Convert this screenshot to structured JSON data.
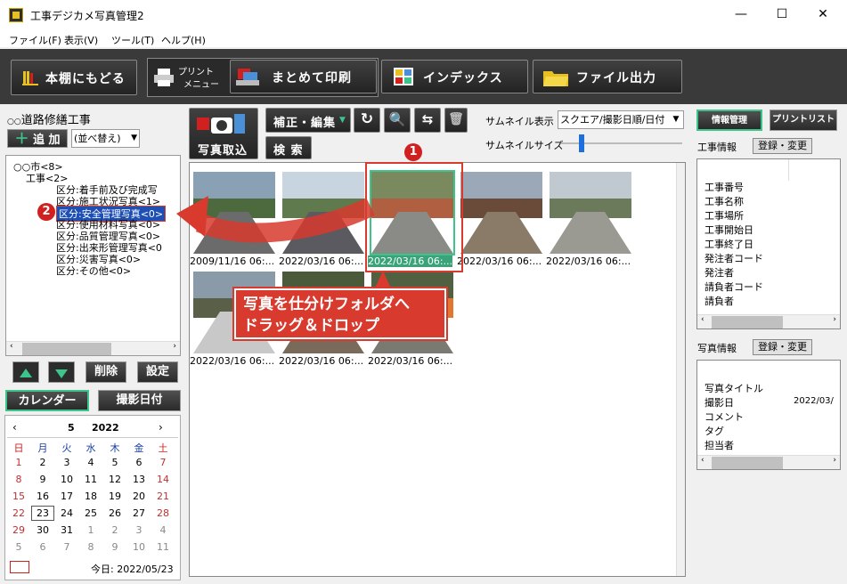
{
  "window": {
    "title": "工事デジカメ写真管理2",
    "minimize": "—",
    "maximize": "☐",
    "close": "✕"
  },
  "menu": [
    "ファイル(F)",
    "表示(V)",
    "ツール(T)",
    "ヘルプ(H)"
  ],
  "toolbar": {
    "back_label": "本棚にもどる",
    "print_menu_label_1": "プリント",
    "print_menu_label_2": "メニュー",
    "batch_print": "まとめて印刷",
    "index": "インデックス",
    "file_output": "ファイル出力"
  },
  "left": {
    "project_title": "道路修繕工事",
    "add_label": "追 加",
    "sort_label": "(並べ替え)",
    "tree": [
      {
        "text": "○○市<8>",
        "indent": 0
      },
      {
        "text": "工事<2>",
        "indent": 1
      },
      {
        "text": "区分:着手前及び完成写",
        "indent": 2
      },
      {
        "text": "区分:施工状況写真<1>",
        "indent": 2
      },
      {
        "text": "区分:安全管理写真<0>",
        "indent": 2,
        "selected": true
      },
      {
        "text": "区分:使用材料写真<0>",
        "indent": 2
      },
      {
        "text": "区分:品質管理写真<0>",
        "indent": 2
      },
      {
        "text": "区分:出来形管理写真<0",
        "indent": 2
      },
      {
        "text": "区分:災害写真<0>",
        "indent": 2
      },
      {
        "text": "区分:その他<0>",
        "indent": 2
      }
    ],
    "delete_label": "削除",
    "settings_label": "設定",
    "calendar_tab": "カレンダー",
    "shoot_date_tab": "撮影日付"
  },
  "calendar": {
    "month": "5",
    "year": "2022",
    "weekdays": [
      "日",
      "月",
      "火",
      "水",
      "木",
      "金",
      "土"
    ],
    "weeks": [
      [
        "1",
        "2",
        "3",
        "4",
        "5",
        "6",
        "7"
      ],
      [
        "8",
        "9",
        "10",
        "11",
        "12",
        "13",
        "14"
      ],
      [
        "15",
        "16",
        "17",
        "18",
        "19",
        "20",
        "21"
      ],
      [
        "22",
        "23",
        "24",
        "25",
        "26",
        "27",
        "28"
      ],
      [
        "29",
        "30",
        "31",
        "1",
        "2",
        "3",
        "4"
      ],
      [
        "5",
        "6",
        "7",
        "8",
        "9",
        "10",
        "11"
      ]
    ],
    "today_label": "今日: 2022/05/23"
  },
  "center": {
    "import_label": "写真取込",
    "edit_label": "補正・編集",
    "search_label": "検 索",
    "thumb_display_label": "サムネイル表示",
    "thumb_display_value": "スクエア/撮影日順/日付",
    "thumb_size_label": "サムネイルサイズ",
    "thumb_size_level": 0.3,
    "photos": [
      {
        "caption": "2009/11/16 06:..."
      },
      {
        "caption": "2022/03/16 06:..."
      },
      {
        "caption": "2022/03/16 06:...",
        "selected": true
      },
      {
        "caption": "2022/03/16 06:..."
      },
      {
        "caption": "2022/03/16 06:..."
      },
      {
        "caption": "2022/03/16 06:..."
      },
      {
        "caption": "2022/03/16 06:..."
      },
      {
        "caption": "2022/03/16 06:..."
      }
    ]
  },
  "callout": {
    "line1": "写真を仕分けフォルダへ",
    "line2": "ドラッグ＆ドロップ",
    "badge1": "1",
    "badge2": "2"
  },
  "right": {
    "info_tab": "情報管理",
    "print_list_tab": "プリントリスト",
    "project_info_label": "工事情報",
    "register_label": "登録・変更",
    "project_fields": [
      "工事番号",
      "工事名称",
      "工事場所",
      "工事開始日",
      "工事終了日",
      "発注者コード",
      "発注者",
      "請負者コード",
      "請負者"
    ],
    "photo_info_label": "写真情報",
    "photo_fields": [
      "写真タイトル",
      "撮影日",
      "コメント",
      "タグ",
      "担当者"
    ],
    "photo_date_value": "2022/03/"
  }
}
